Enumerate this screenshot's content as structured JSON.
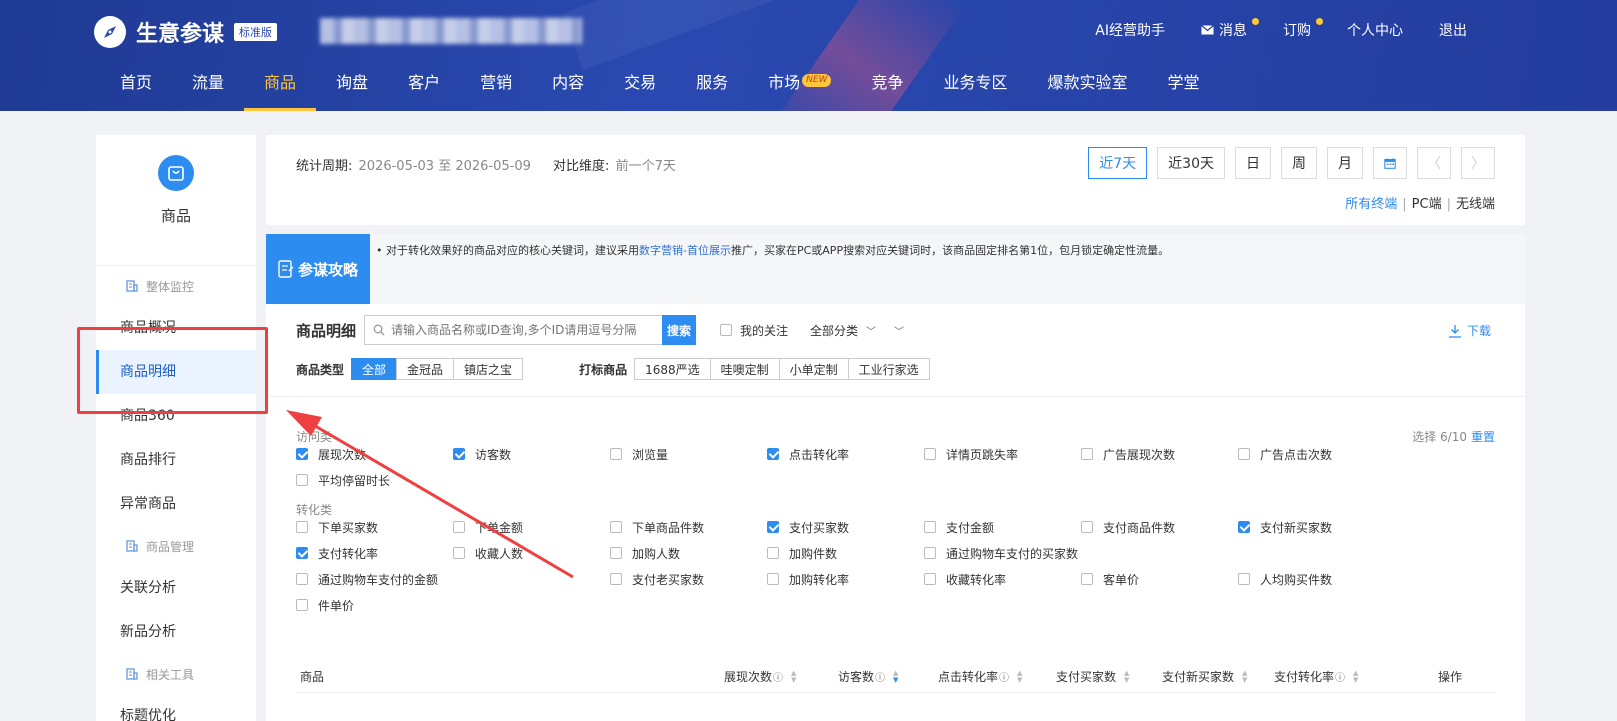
{
  "header": {
    "logo_title": "生意参谋",
    "logo_badge": "标准版",
    "links": [
      {
        "label": "AI经营助手",
        "icon": "",
        "dot": false
      },
      {
        "label": "消息",
        "icon": "mail-icon",
        "dot": true
      },
      {
        "label": "订购",
        "icon": "",
        "dot": true
      },
      {
        "label": "个人中心",
        "icon": "",
        "dot": false
      },
      {
        "label": "退出",
        "icon": "",
        "dot": false
      }
    ],
    "nav": [
      {
        "label": "首页"
      },
      {
        "label": "流量"
      },
      {
        "label": "商品",
        "active": true
      },
      {
        "label": "询盘"
      },
      {
        "label": "客户"
      },
      {
        "label": "营销"
      },
      {
        "label": "内容"
      },
      {
        "label": "交易"
      },
      {
        "label": "服务"
      },
      {
        "label": "市场",
        "badge": "NEW"
      },
      {
        "label": "竞争"
      },
      {
        "label": "业务专区"
      },
      {
        "label": "爆款实验室"
      },
      {
        "label": "学堂"
      }
    ]
  },
  "sidebar": {
    "title": "商品",
    "groups": [
      {
        "label": "整体监控",
        "items": [
          {
            "label": "商品概况"
          },
          {
            "label": "商品明细",
            "active": true
          },
          {
            "label": "商品360"
          },
          {
            "label": "商品排行"
          },
          {
            "label": "异常商品"
          }
        ]
      },
      {
        "label": "商品管理",
        "items": [
          {
            "label": "关联分析"
          },
          {
            "label": "新品分析"
          }
        ]
      },
      {
        "label": "相关工具",
        "items": [
          {
            "label": "标题优化"
          }
        ]
      }
    ]
  },
  "period": {
    "label": "统计周期:",
    "value": "2026-05-03 至 2026-05-09",
    "compare_label": "对比维度:",
    "compare_value": "前一个7天"
  },
  "date_buttons": [
    "近7天",
    "近30天",
    "日",
    "周",
    "月"
  ],
  "terminals": [
    "所有终端",
    "PC端",
    "无线端"
  ],
  "tip": {
    "badge": "参谋攻略",
    "text_before": "对于转化效果好的商品对应的核心关键词，建议采用",
    "link": "数字营销-首位展示",
    "text_after": "推广，买家在PC或APP搜索对应关键词时，该商品固定排名第1位，包月锁定确定性流量。"
  },
  "toolbar": {
    "title": "商品明细",
    "search_placeholder": "请输入商品名称或ID查询,多个ID请用逗号分隔",
    "search_button": "搜索",
    "follow_label": "我的关注",
    "category": "全部分类",
    "download": "下载"
  },
  "filters": {
    "type_label": "商品类型",
    "types": [
      "全部",
      "金冠品",
      "镇店之宝"
    ],
    "tag_label": "打标商品",
    "tags": [
      "1688严选",
      "哇噢定制",
      "小单定制",
      "工业行家选"
    ]
  },
  "metrics": {
    "select_count": "选择 6/10",
    "reset": "重置",
    "groups": [
      {
        "title": "访问类",
        "rows": [
          [
            {
              "label": "展现次数",
              "checked": true
            },
            {
              "label": "访客数",
              "checked": true
            },
            {
              "label": "浏览量",
              "checked": false
            },
            {
              "label": "点击转化率",
              "checked": true
            },
            {
              "label": "详情页跳失率",
              "checked": false
            },
            {
              "label": "广告展现次数",
              "checked": false
            },
            {
              "label": "广告点击次数",
              "checked": false
            }
          ],
          [
            {
              "label": "平均停留时长",
              "checked": false
            }
          ]
        ]
      },
      {
        "title": "转化类",
        "rows": [
          [
            {
              "label": "下单买家数",
              "checked": false
            },
            {
              "label": "下单金额",
              "checked": false
            },
            {
              "label": "下单商品件数",
              "checked": false
            },
            {
              "label": "支付买家数",
              "checked": true
            },
            {
              "label": "支付金额",
              "checked": false
            },
            {
              "label": "支付商品件数",
              "checked": false
            },
            {
              "label": "支付新买家数",
              "checked": true
            }
          ],
          [
            {
              "label": "支付转化率",
              "checked": true
            },
            {
              "label": "收藏人数",
              "checked": false
            },
            {
              "label": "加购人数",
              "checked": false
            },
            {
              "label": "加购件数",
              "checked": false
            },
            {
              "label": "通过购物车支付的买家数",
              "checked": false
            }
          ],
          [
            {
              "label": "通过购物车支付的金额",
              "checked": false
            },
            {
              "label": "",
              "checked": null
            },
            {
              "label": "支付老买家数",
              "checked": false
            },
            {
              "label": "加购转化率",
              "checked": false
            },
            {
              "label": "收藏转化率",
              "checked": false
            },
            {
              "label": "客单价",
              "checked": false
            },
            {
              "label": "人均购买件数",
              "checked": false
            }
          ],
          [
            {
              "label": "件单价",
              "checked": false
            }
          ]
        ]
      }
    ]
  },
  "table": {
    "columns": [
      {
        "label": "商品",
        "help": false,
        "sort": false
      },
      {
        "label": "展现次数",
        "help": true,
        "sort": true
      },
      {
        "label": "访客数",
        "help": true,
        "sort": true,
        "active": true
      },
      {
        "label": "点击转化率",
        "help": true,
        "sort": true
      },
      {
        "label": "支付买家数",
        "help": false,
        "sort": true
      },
      {
        "label": "支付新买家数",
        "help": false,
        "sort": true
      },
      {
        "label": "支付转化率",
        "help": true,
        "sort": true
      },
      {
        "label": "操作",
        "help": false,
        "sort": false
      }
    ]
  },
  "colors": {
    "accent": "#2d8cf0",
    "header_bg": "#243d9e",
    "nav_active": "#ffc53d",
    "annotation": "#ee4040"
  }
}
